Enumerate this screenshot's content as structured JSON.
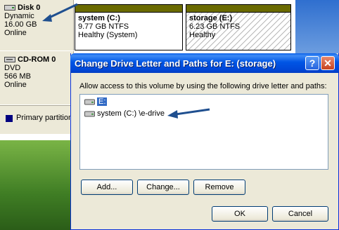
{
  "disks": [
    {
      "title": "Disk 0",
      "lines": [
        "Dynamic",
        "16.00 GB",
        "Online"
      ]
    },
    {
      "title": "CD-ROM 0",
      "lines": [
        "DVD",
        "566 MB",
        "Online"
      ]
    }
  ],
  "partitions": [
    {
      "name": "system  (C:)",
      "size": "9.77 GB NTFS",
      "status": "Healthy (System)"
    },
    {
      "name": "storage  (E:)",
      "size": "6.23 GB NTFS",
      "status": "Healthy"
    }
  ],
  "legend": {
    "label": "Primary partition",
    "color": "#000080"
  },
  "dialog": {
    "title": "Change Drive Letter and Paths for E: (storage)",
    "help_label": "?",
    "close_label": "✕",
    "description": "Allow access to this volume by using the following drive letter and paths:",
    "list_items": [
      {
        "label": "E:",
        "selected": true,
        "icon": "drive-icon"
      },
      {
        "label": "system (C:) \\e-drive",
        "selected": false,
        "icon": "drive-icon"
      }
    ],
    "buttons": {
      "add": "Add...",
      "change": "Change...",
      "remove": "Remove",
      "ok": "OK",
      "cancel": "Cancel"
    }
  },
  "colors": {
    "titlebar": "#0055e5",
    "selection": "#316ac5",
    "partition_band": "#6b6b00",
    "annotation_arrow": "#1f4f8f"
  }
}
